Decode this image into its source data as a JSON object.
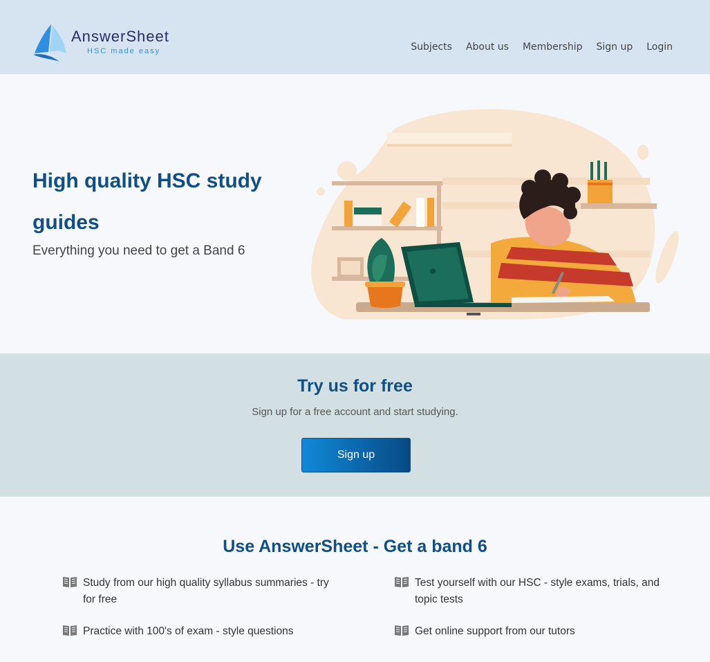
{
  "brand": {
    "name": "AnswerSheet",
    "tagline": "HSC made easy"
  },
  "nav": [
    "Subjects",
    "About us",
    "Membership",
    "Sign up",
    "Login"
  ],
  "hero": {
    "title": "High quality HSC study guides",
    "subtitle": "Everything you need to get a Band 6"
  },
  "cta": {
    "title": "Try us for free",
    "subtitle": "Sign up for a free account and start studying.",
    "button": "Sign up"
  },
  "features": {
    "title": "Use AnswerSheet - Get a band 6",
    "items": [
      {
        "icon": "book-icon",
        "text": "Study from our high quality syllabus summaries - try for free"
      },
      {
        "icon": "book-icon",
        "text": "Test yourself with our HSC - style exams, trials, and topic tests"
      },
      {
        "icon": "book-icon",
        "text": "Practice with 100's of exam - style questions"
      },
      {
        "icon": "book-icon",
        "text": "Get online support from our tutors"
      }
    ]
  },
  "colors": {
    "header_bg": "#d6e3f0",
    "heading": "#0f4f86",
    "cta_bg": "#d2e0e4",
    "button_start": "#1189d8",
    "button_end": "#074a85"
  }
}
